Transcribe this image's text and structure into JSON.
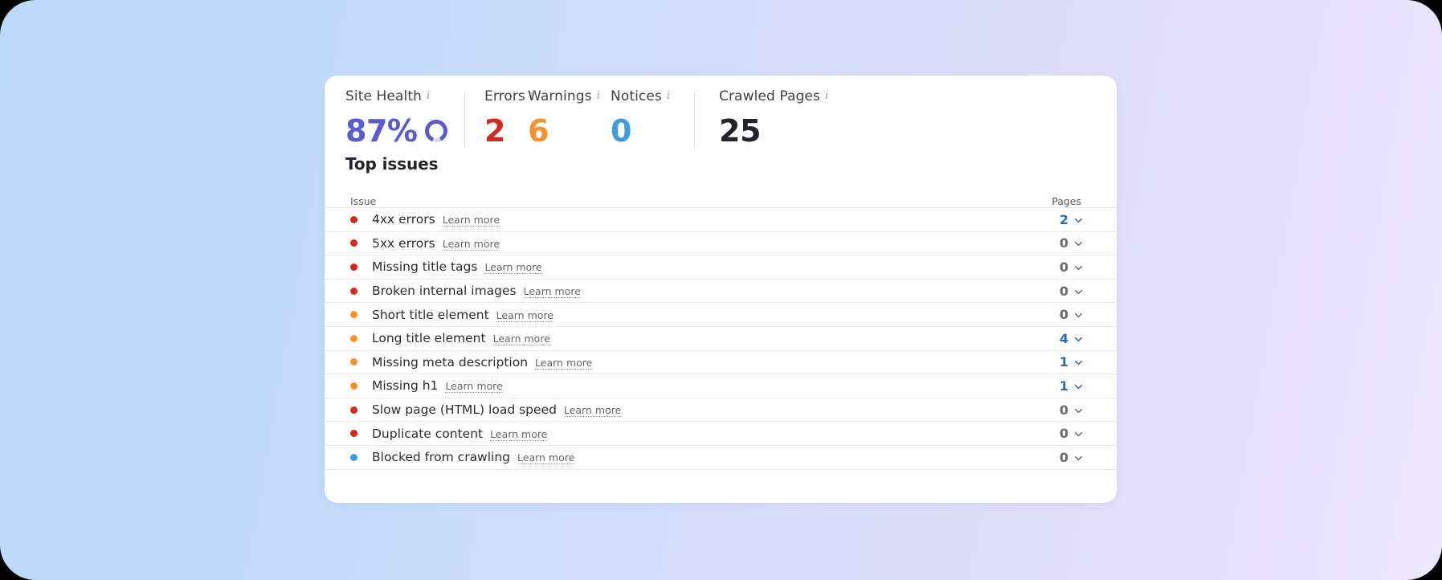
{
  "theme": {
    "bg_gradient_from": "#bcd8fb",
    "bg_gradient_to": "#ece7fe",
    "card_bg": "#ffffff",
    "health_color": "#5a5ad1",
    "errors_color": "#d32a1e",
    "warnings_color": "#f5932e",
    "notices_color": "#3c9ee0",
    "crawled_color": "#23232b",
    "link_color": "#2b6cb8"
  },
  "summary": {
    "info_glyph": "i",
    "stats": [
      {
        "label": "Site Health",
        "value": "87%",
        "color": "#5a5ad1",
        "has_donut": true,
        "donut_percent": 87
      },
      {
        "label": "Errors",
        "value": "2",
        "color": "#d32a1e",
        "has_donut": false
      },
      {
        "label": "Warnings",
        "value": "6",
        "color": "#f5932e",
        "has_donut": false
      },
      {
        "label": "Notices",
        "value": "0",
        "color": "#3c9ee0",
        "has_donut": false
      },
      {
        "label": "Crawled Pages",
        "value": "25",
        "color": "#23232b",
        "has_donut": false
      }
    ]
  },
  "top_issues": {
    "title": "Top issues",
    "columns": {
      "issue": "Issue",
      "pages": "Pages"
    },
    "learn_more_label": "Learn more",
    "rows": [
      {
        "severity": "error",
        "name": "4xx errors",
        "learn_more": "Learn more",
        "pages": "2"
      },
      {
        "severity": "error",
        "name": "5xx errors",
        "learn_more": "Learn more",
        "pages": "0"
      },
      {
        "severity": "error",
        "name": "Missing title tags",
        "learn_more": "Learn more",
        "pages": "0"
      },
      {
        "severity": "error",
        "name": "Broken internal images",
        "learn_more": "Learn more",
        "pages": "0"
      },
      {
        "severity": "warning",
        "name": "Short title element",
        "learn_more": "Learn more",
        "pages": "0"
      },
      {
        "severity": "warning",
        "name": "Long title element",
        "learn_more": "Learn more",
        "pages": "4"
      },
      {
        "severity": "warning",
        "name": "Missing meta description",
        "learn_more": "Learn more",
        "pages": "1"
      },
      {
        "severity": "warning",
        "name": "Missing h1",
        "learn_more": "Learn more",
        "pages": "1"
      },
      {
        "severity": "error",
        "name": "Slow page (HTML) load speed",
        "learn_more": "Learn more",
        "pages": "0"
      },
      {
        "severity": "error",
        "name": "Duplicate content",
        "learn_more": "Learn more",
        "pages": "0"
      },
      {
        "severity": "notice",
        "name": "Blocked from crawling",
        "learn_more": "Learn more",
        "pages": "0"
      }
    ]
  }
}
